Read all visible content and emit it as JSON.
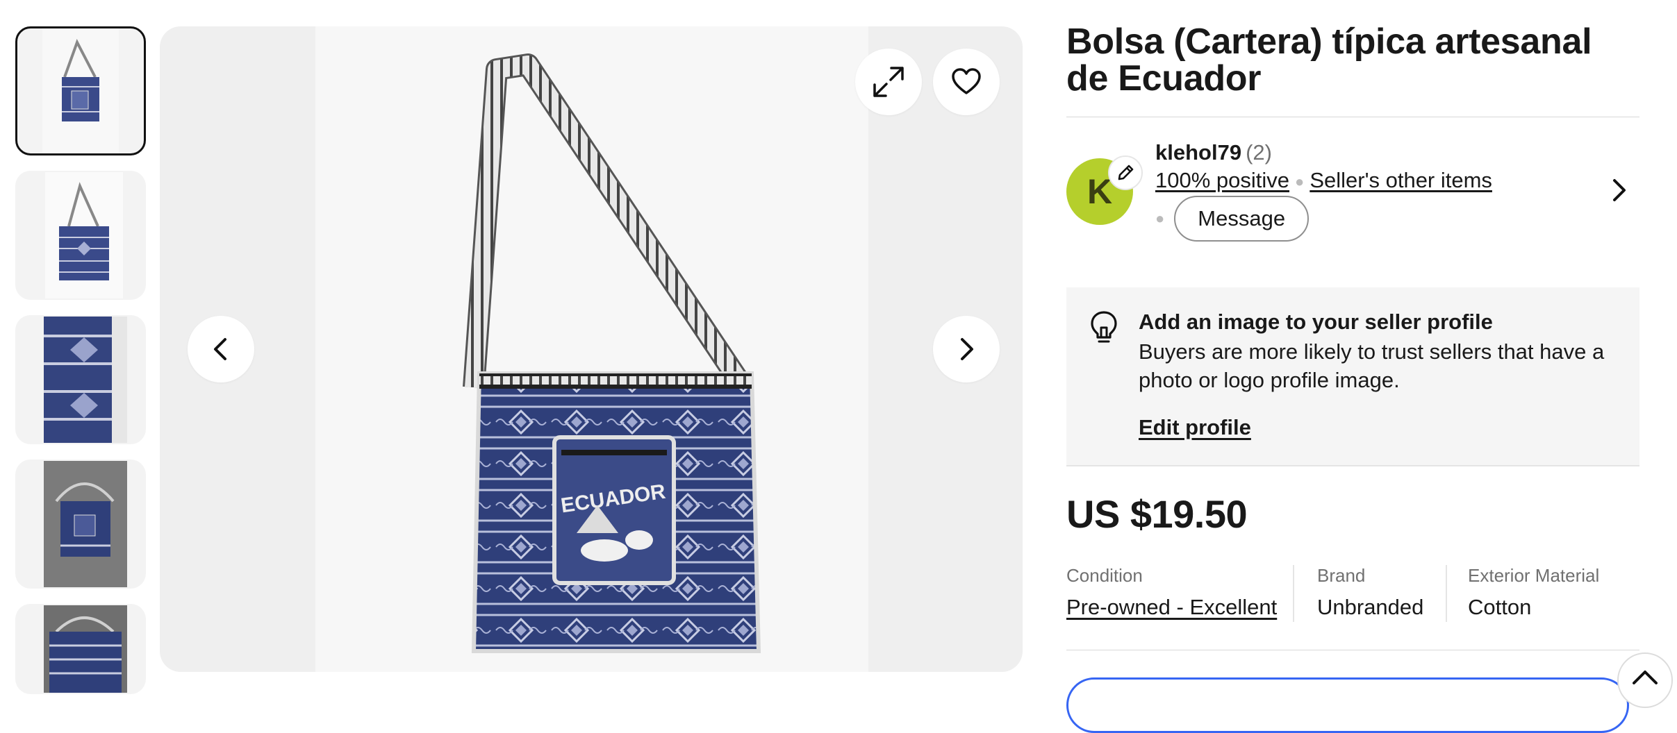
{
  "listing": {
    "title": "Bolsa (Cartera) típica artesanal de Ecuador"
  },
  "gallery": {
    "thumbnail_count": 5,
    "active_index": 0,
    "icons": {
      "expand": "expand-icon",
      "favorite": "heart-icon",
      "prev": "chevron-left-icon",
      "next": "chevron-right-icon"
    }
  },
  "seller": {
    "avatar_initial": "K",
    "name": "klehol79",
    "feedback_count": "(2)",
    "positive": "100% positive",
    "other_items": "Seller's other items",
    "message_label": "Message"
  },
  "tip": {
    "heading": "Add an image to your seller profile",
    "body": "Buyers are more likely to trust sellers that have a photo or logo profile image.",
    "link": "Edit profile"
  },
  "price": "US $19.50",
  "attributes": [
    {
      "label": "Condition",
      "value": "Pre-owned - Excellent"
    },
    {
      "label": "Brand",
      "value": "Unbranded"
    },
    {
      "label": "Exterior Material",
      "value": "Cotton"
    }
  ],
  "colors": {
    "avatar_bg": "#b5cf2c",
    "accent_blue": "#3665f3",
    "bag_navy": "#2f3f7a"
  }
}
